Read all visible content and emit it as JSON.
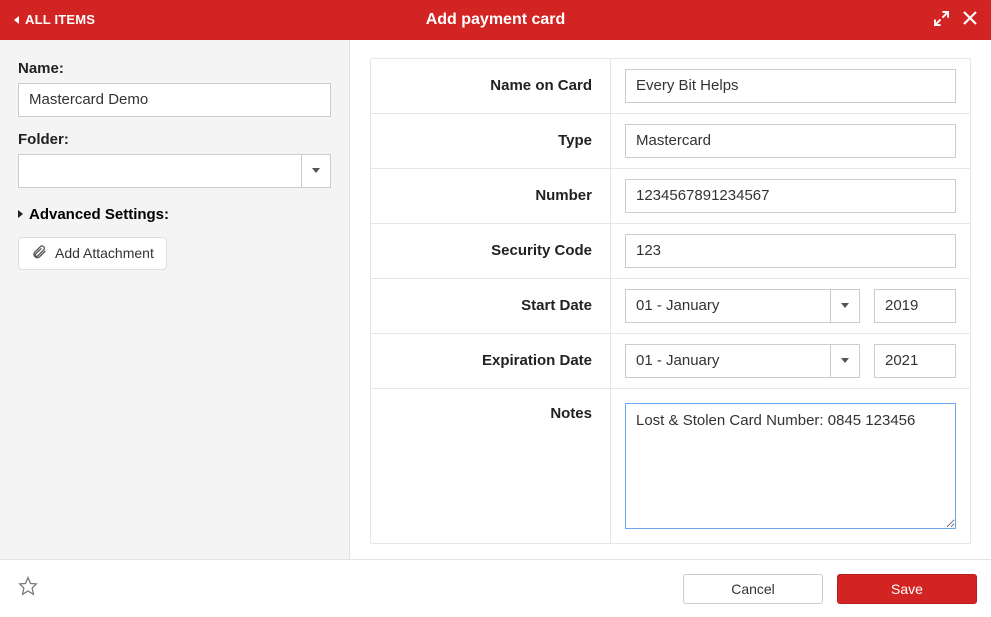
{
  "header": {
    "back_label": "ALL ITEMS",
    "title": "Add payment card"
  },
  "left": {
    "name_label": "Name:",
    "name_value": "Mastercard Demo",
    "folder_label": "Folder:",
    "folder_value": "",
    "advanced_label": "Advanced Settings:",
    "attach_label": "Add Attachment"
  },
  "form": {
    "name_on_card": {
      "label": "Name on Card",
      "value": "Every Bit Helps"
    },
    "type": {
      "label": "Type",
      "value": "Mastercard"
    },
    "number": {
      "label": "Number",
      "value": "1234567891234567"
    },
    "security": {
      "label": "Security Code",
      "value": "123"
    },
    "start_date": {
      "label": "Start Date",
      "month": "01 - January",
      "year": "2019"
    },
    "exp_date": {
      "label": "Expiration Date",
      "month": "01 - January",
      "year": "2021"
    },
    "notes": {
      "label": "Notes",
      "value": "Lost & Stolen Card Number: 0845 123456"
    }
  },
  "footer": {
    "cancel": "Cancel",
    "save": "Save"
  }
}
